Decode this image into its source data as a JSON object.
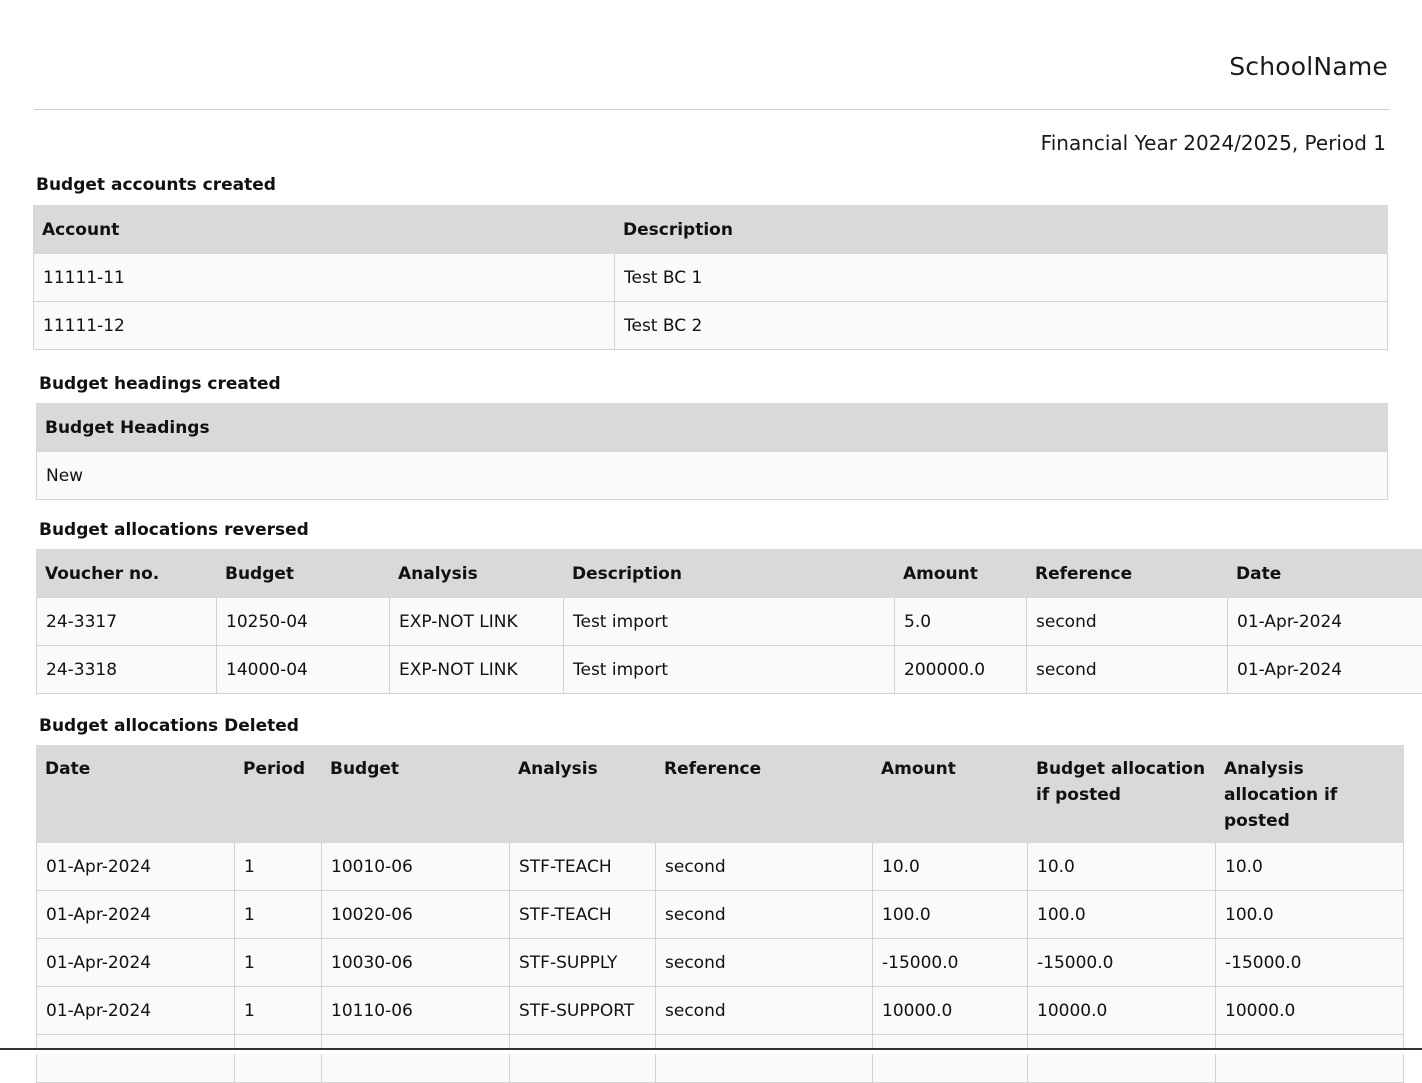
{
  "header": {
    "school_name": "SchoolName",
    "period_line": "Financial Year 2024/2025, Period 1"
  },
  "accounts": {
    "title": "Budget accounts created",
    "columns": [
      "Account",
      "Description"
    ],
    "rows": [
      [
        "11111-11",
        "Test BC 1"
      ],
      [
        "11111-12",
        "Test BC 2"
      ]
    ]
  },
  "headings": {
    "title": "Budget headings created",
    "columns": [
      "Budget Headings"
    ],
    "rows": [
      [
        "New"
      ]
    ]
  },
  "reversed": {
    "title": "Budget allocations reversed",
    "columns": [
      "Voucher no.",
      "Budget",
      "Analysis",
      "Description",
      "Amount",
      "Reference",
      "Date"
    ],
    "rows": [
      [
        "24-3317",
        "10250-04",
        "EXP-NOT LINK",
        "Test import",
        "5.0",
        "second",
        "01-Apr-2024"
      ],
      [
        "24-3318",
        "14000-04",
        "EXP-NOT LINK",
        "Test import",
        "200000.0",
        "second",
        "01-Apr-2024"
      ]
    ]
  },
  "deleted": {
    "title": "Budget allocations Deleted",
    "columns": [
      "Date",
      "Period",
      "Budget",
      "Analysis",
      "Reference",
      "Amount",
      "Budget allocation if posted",
      "Analysis allocation if posted"
    ],
    "rows": [
      [
        "01-Apr-2024",
        "1",
        "10010-06",
        "STF-TEACH",
        "second",
        "10.0",
        "10.0",
        "10.0"
      ],
      [
        "01-Apr-2024",
        "1",
        "10020-06",
        "STF-TEACH",
        "second",
        "100.0",
        "100.0",
        "100.0"
      ],
      [
        "01-Apr-2024",
        "1",
        "10030-06",
        "STF-SUPPLY",
        "second",
        "-15000.0",
        "-15000.0",
        "-15000.0"
      ],
      [
        "01-Apr-2024",
        "1",
        "10110-06",
        "STF-SUPPORT",
        "second",
        "10000.0",
        "10000.0",
        "10000.0"
      ],
      [
        "",
        "",
        "",
        "",
        "",
        "",
        "",
        ""
      ]
    ]
  }
}
